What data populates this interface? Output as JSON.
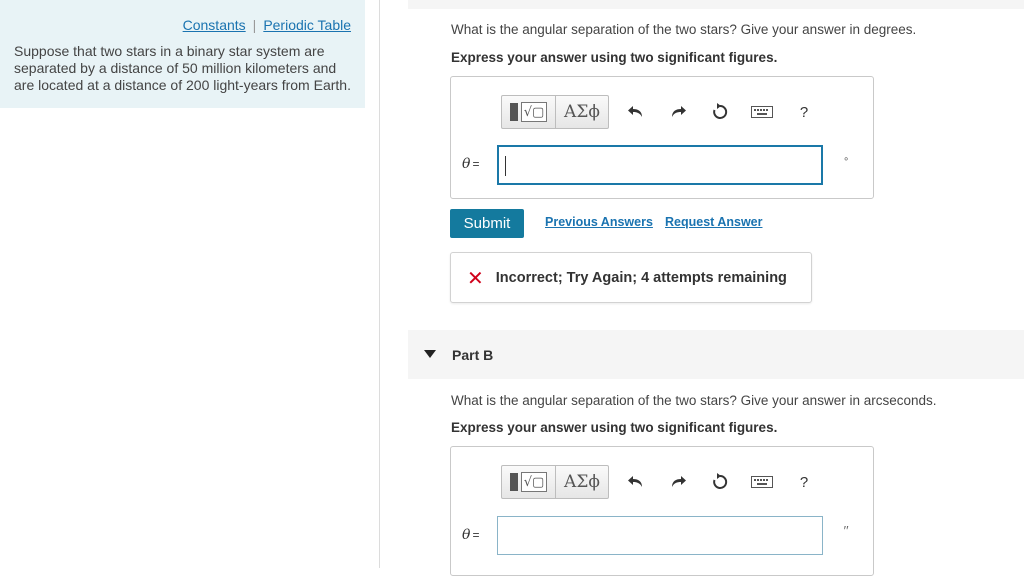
{
  "left": {
    "links": [
      "Constants",
      "Periodic Table"
    ],
    "separator": "|",
    "text": "Suppose that two stars in a binary star system are separated by a distance of 50 million kilometers and are located at a distance of 200 light-years from Earth."
  },
  "partA": {
    "question": "What is the angular separation of the two stars? Give your answer in degrees.",
    "instruction": "Express your answer using two significant figures.",
    "toolbar": {
      "greek": "ΑΣϕ",
      "help": "?"
    },
    "variable": "θ",
    "equals": "=",
    "value": "",
    "unit": "∘",
    "submit": "Submit",
    "previous_answers": "Previous Answers",
    "request_answer": "Request Answer",
    "feedback_icon": "✕",
    "feedback": "Incorrect; Try Again; 4 attempts remaining"
  },
  "partB": {
    "title": "Part B",
    "question": "What is the angular separation of the two stars? Give your answer in arcseconds.",
    "instruction": "Express your answer using two significant figures.",
    "toolbar": {
      "greek": "ΑΣϕ",
      "help": "?"
    },
    "variable": "θ",
    "equals": "=",
    "value": "",
    "unit": "′′"
  },
  "colors": {
    "accent": "#147a9e",
    "link": "#1a73b0",
    "panel": "#e8f3f6",
    "error": "#d0021b"
  }
}
